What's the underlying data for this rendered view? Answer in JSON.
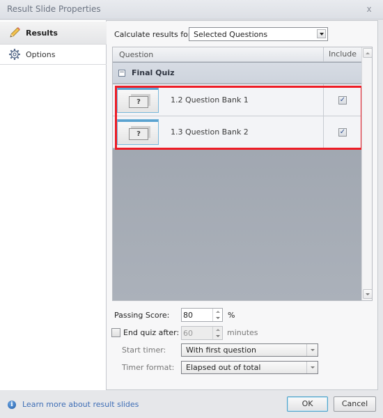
{
  "window": {
    "title": "Result Slide Properties",
    "close_label": "x"
  },
  "sidebar": {
    "items": [
      {
        "label": "Results",
        "icon": "pencil-icon",
        "active": true
      },
      {
        "label": "Options",
        "icon": "gear-icon",
        "active": false
      }
    ]
  },
  "main": {
    "calculate_label": "Calculate results for:",
    "calculate_value": "Selected Questions",
    "grid": {
      "columns": [
        "Question",
        "Include"
      ],
      "group": {
        "toggle": "−",
        "name": "Final Quiz"
      },
      "rows": [
        {
          "thumb_glyph": "?",
          "name": "1.2 Question Bank 1",
          "include": true,
          "check": "✓"
        },
        {
          "thumb_glyph": "?",
          "name": "1.3 Question Bank 2",
          "include": true,
          "check": "✓"
        }
      ],
      "highlight_color": "#ee1c25"
    },
    "passing_score": {
      "label": "Passing Score:",
      "value": "80",
      "unit": "%"
    },
    "end_quiz": {
      "label": "End quiz after:",
      "checked": false,
      "value": "60",
      "unit": "minutes"
    },
    "start_timer": {
      "label": "Start timer:",
      "value": "With first question"
    },
    "timer_format": {
      "label": "Timer format:",
      "value": "Elapsed out of total"
    }
  },
  "footer": {
    "info_glyph": "i",
    "learn_more": "Learn more about result slides",
    "ok_label": "OK",
    "cancel_label": "Cancel"
  }
}
